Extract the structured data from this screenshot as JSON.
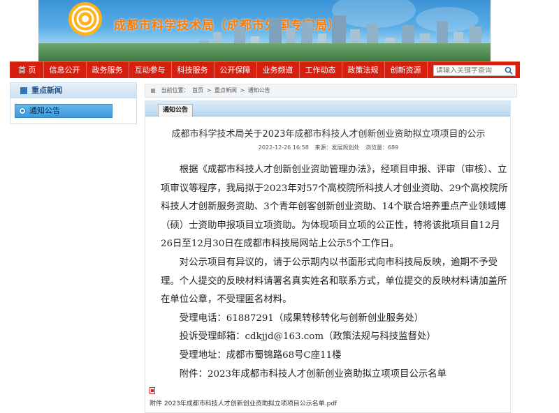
{
  "banner": {
    "title": "成都市科学技术局（成都市外国专家局）"
  },
  "nav": {
    "items": [
      "首 页",
      "信息公开",
      "政务服务",
      "互动参与",
      "科技服务",
      "公开保障",
      "业务频道",
      "工作动态",
      "政策法规",
      "创新资源"
    ],
    "search_placeholder": "请输入关键字查询"
  },
  "sidebar": {
    "heading": "重点新闻",
    "item": "通知公告"
  },
  "breadcrumb": {
    "prefix": "当前位置：",
    "items": [
      "首页",
      "重点新闻",
      "通知公告"
    ],
    "sep": ">"
  },
  "main": {
    "tab": "通知公告",
    "title": "成都市科学技术局关于2023年成都市科技人才创新创业资助拟立项项目的公示",
    "date": "2022-12-26 16:58",
    "source": "来源：发展规划处",
    "views": "浏览量：689",
    "para1_line1": "根据《成都市科技人才创新创业资助管理办法》，经项目申报、评审（审核）、立",
    "para1_rest": "项审议等程序，我局拟于2023年对57个高校院所科技人才创业资助、29个高校院所科技人才创新服务资助、3个青年创客创新创业资助、14个联合培养重点产业领域博（硕）士资助申报项目立项资助。为体现项目立项的公正性，特将该批项目自12月26日至12月30日在成都市科技局网站上公示5个工作日。",
    "para2": "对公示项目有异议的，请于公示期内以书面形式向市科技局反映，逾期不予受理。个人提交的反映材料请署名真实姓名和联系方式，单位提交的反映材料请加盖所在单位公章，不受理匿名材料。",
    "phone": "受理电话：61887291（成果转移转化与创新创业服务处）",
    "email": "投诉受理邮箱：cdkjjd@163.com（政策法规与科技监督处）",
    "address": "受理地址：成都市蜀锦路68号C座11楼",
    "attachment_label": "附件：2023年成都市科技人才创新创业资助拟立项项目公示名单",
    "attachment_file": "附件 2023年成都市科技人才创新创业资助拟立项项目公示名单.pdf"
  },
  "colors": {
    "nav_red": "#d61f0f",
    "title_orange": "#ff7a00",
    "sidebar_blue": "#3f97d8"
  }
}
